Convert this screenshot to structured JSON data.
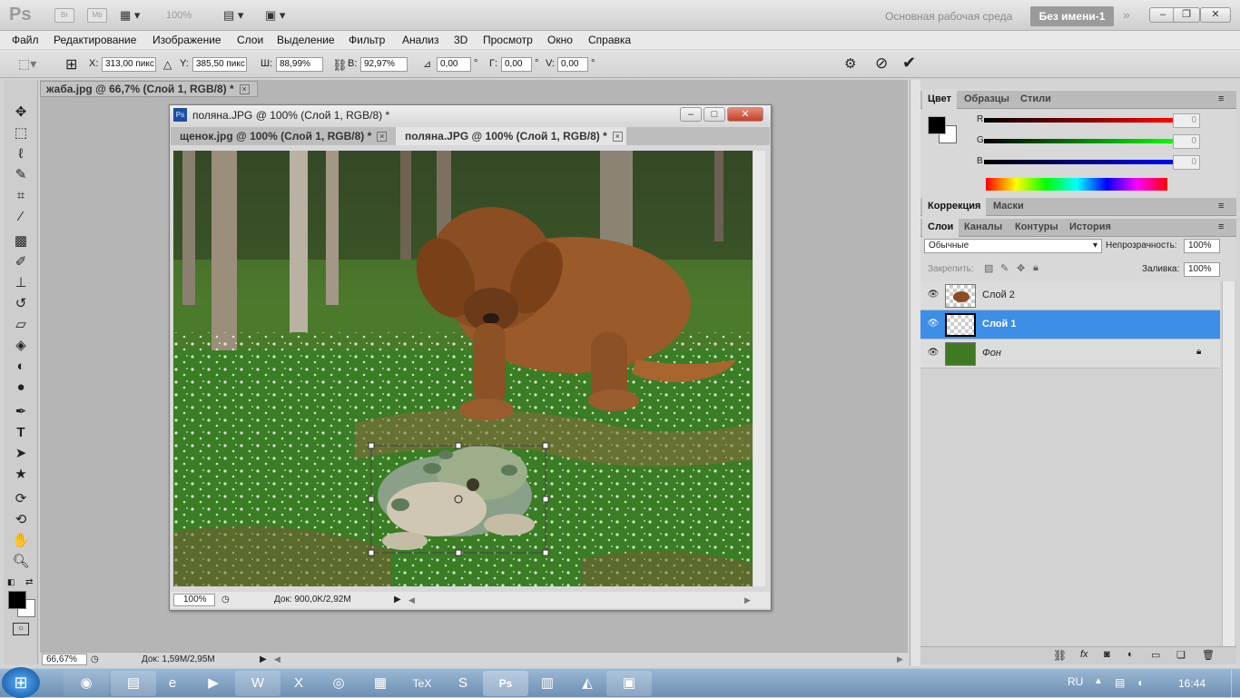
{
  "app": {
    "logo": "Ps",
    "bridge": "Br",
    "minibridge": "Mb",
    "zoom": "100%",
    "workspace": "Основная рабочая среда",
    "workspace_btn": "Без имени-1"
  },
  "menu": [
    "Файл",
    "Редактирование",
    "Изображение",
    "Слои",
    "Выделение",
    "Фильтр",
    "Анализ",
    "3D",
    "Просмотр",
    "Окно",
    "Справка"
  ],
  "options": {
    "x_label": "X:",
    "x_value": "313,00 пикс",
    "y_label": "Y:",
    "y_value": "385,50 пикс",
    "w_label": "Ш:",
    "w_value": "88,99%",
    "h_label": "В:",
    "h_value": "92,97%",
    "angle_value": "0,00",
    "deg": "°",
    "g_label": "Г:",
    "g_value": "0,00",
    "v_label": "V:",
    "v_value": "0,00"
  },
  "doc_tab": "жаба.jpg @ 66,7% (Слой 1, RGB/8) *",
  "doc_window": {
    "title": "поляна.JPG @ 100% (Слой 1, RGB/8) *",
    "tabs": [
      "щенок.jpg @ 100% (Слой 1, RGB/8) *",
      "поляна.JPG @ 100% (Слой 1, RGB/8) *"
    ],
    "zoom": "100%",
    "doc_size": "Док: 900,0K/2,92M"
  },
  "status": {
    "zoom": "66,67%",
    "doc_size": "Док: 1,59M/2,95M"
  },
  "color_panel": {
    "tabs": [
      "Цвет",
      "Образцы",
      "Стили"
    ],
    "channels": [
      {
        "label": "R",
        "value": "0",
        "color": "#e0141e"
      },
      {
        "label": "G",
        "value": "0",
        "color": "#1ec81e"
      },
      {
        "label": "B",
        "value": "0",
        "color": "#1e1ee0"
      }
    ]
  },
  "adjust_panel": {
    "tabs": [
      "Коррекция",
      "Маски"
    ]
  },
  "layers_panel": {
    "tabs": [
      "Слои",
      "Каналы",
      "Контуры",
      "История"
    ],
    "blend_mode": "Обычные",
    "opacity_label": "Непрозрачность:",
    "opacity": "100%",
    "lock_label": "Закрепить:",
    "fill_label": "Заливка:",
    "fill": "100%",
    "layers": [
      {
        "name": "Слой 2",
        "selected": false
      },
      {
        "name": "Слой 1",
        "selected": true
      },
      {
        "name": "Фон",
        "selected": false,
        "locked": true
      }
    ]
  },
  "taskbar": {
    "lang": "RU",
    "time": "16:44"
  }
}
